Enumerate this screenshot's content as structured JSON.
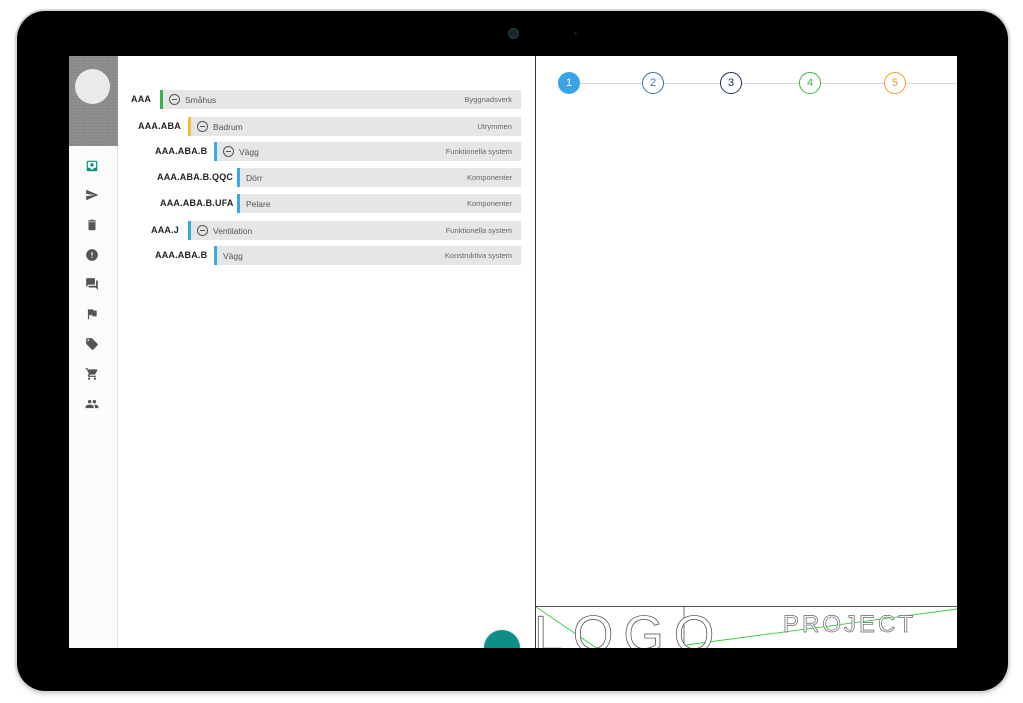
{
  "rail": {
    "icons": [
      "inbox-icon",
      "send-icon",
      "delete-icon",
      "alert-icon",
      "chat-icon",
      "flag-icon",
      "tag-icon",
      "cart-icon",
      "people-icon"
    ],
    "accent": "#0e8f86"
  },
  "tree": {
    "rows": [
      {
        "code": "AAA",
        "name": "Småhus",
        "type": "Byggnadsverk",
        "stripe": "#3bb34a",
        "collapsible": true
      },
      {
        "code": "AAA.ABA",
        "name": "Badrum",
        "type": "Utrymmen",
        "stripe": "#f2c230",
        "collapsible": true
      },
      {
        "code": "AAA.ABA.B",
        "name": "Vägg",
        "type": "Funktionella system",
        "stripe": "#3aa8e2",
        "collapsible": true
      },
      {
        "code": "AAA.ABA.B.QQC",
        "name": "Dörr",
        "type": "Komponenter",
        "stripe": "#3aa8e2",
        "collapsible": false
      },
      {
        "code": "AAA.ABA.B.UFA",
        "name": "Pelare",
        "type": "Komponenter",
        "stripe": "#3aa8e2",
        "collapsible": false
      },
      {
        "code": "AAA.J",
        "name": "Ventilation",
        "type": "Funktionella system",
        "stripe": "#3aa8e2",
        "collapsible": true
      },
      {
        "code": "AAA.ABA.B",
        "name": "Vägg",
        "type": "Konstruktiva system",
        "stripe": "#3aa8e2",
        "collapsible": false
      }
    ]
  },
  "stepper": {
    "steps": [
      {
        "label": "1",
        "color": "#3aa2e6",
        "filled": true
      },
      {
        "label": "2",
        "color": "#2f72b8",
        "filled": false
      },
      {
        "label": "3",
        "color": "#1f2f55",
        "filled": false
      },
      {
        "label": "4",
        "color": "#3bb34a",
        "filled": false
      },
      {
        "label": "5",
        "color": "#f09a2c",
        "filled": false
      }
    ]
  },
  "drawing": {
    "left_text": "LOGO",
    "right_text": "PROJECT",
    "line_color": "#2fcf3b"
  }
}
